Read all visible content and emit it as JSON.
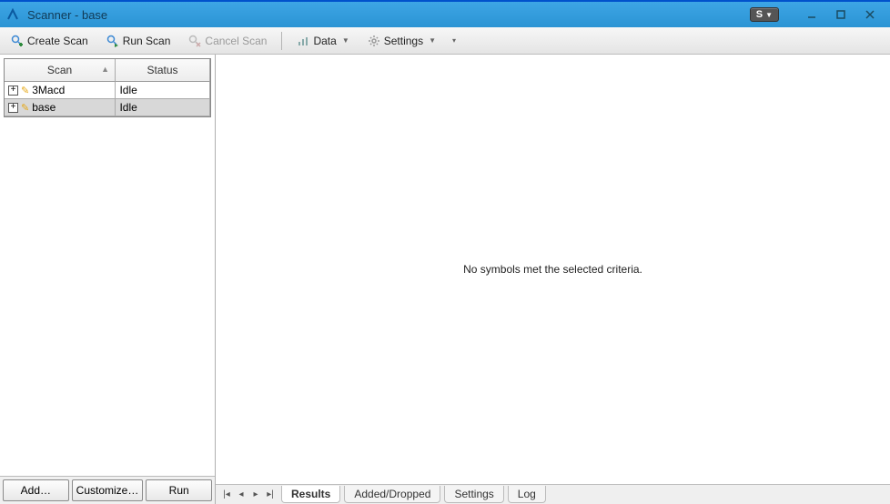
{
  "window": {
    "title": "Scanner - base",
    "badge": "S"
  },
  "toolbar": {
    "create": "Create Scan",
    "run": "Run Scan",
    "cancel": "Cancel Scan",
    "data": "Data",
    "settings": "Settings"
  },
  "table": {
    "headers": {
      "scan": "Scan",
      "status": "Status"
    },
    "rows": [
      {
        "name": "3Macd",
        "status": "Idle",
        "selected": false
      },
      {
        "name": "base",
        "status": "Idle",
        "selected": true
      }
    ]
  },
  "leftButtons": {
    "add": "Add…",
    "customize": "Customize…",
    "run": "Run"
  },
  "results": {
    "empty": "No symbols met the selected criteria."
  },
  "tabs": {
    "results": "Results",
    "addedDropped": "Added/Dropped",
    "settings": "Settings",
    "log": "Log"
  }
}
